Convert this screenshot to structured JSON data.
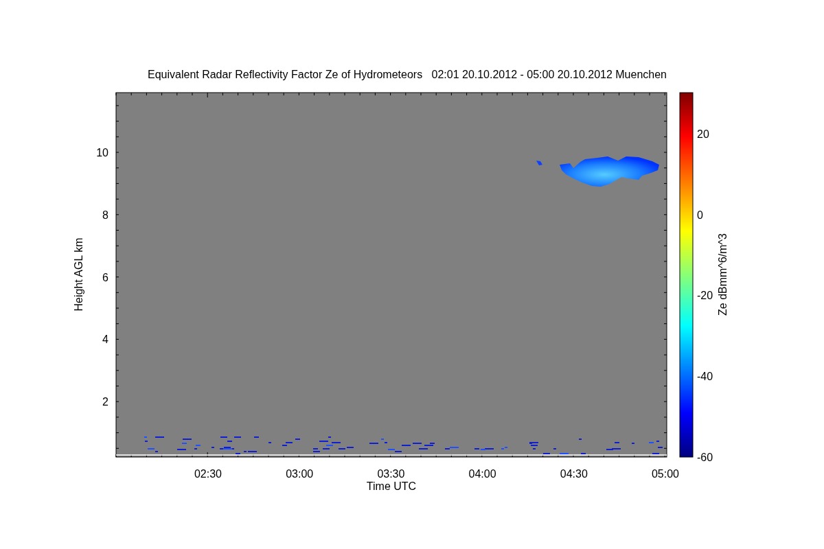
{
  "title": "Equivalent Radar Reflectivity Factor Ze of Hydrometeors   02:01 20.10.2012 - 05:00 20.10.2012 Muenchen",
  "y_axis": {
    "label": "Height AGL km",
    "ticks": [
      "10",
      "8",
      "6",
      "4",
      "2"
    ]
  },
  "x_axis": {
    "label": "Time UTC",
    "ticks": [
      "02:30",
      "03:00",
      "03:30",
      "04:00",
      "04:30",
      "05:00"
    ]
  },
  "colorbar": {
    "label": "Ze dBmm^6/m^3",
    "ticks": [
      "20",
      "0",
      "-20",
      "-40",
      "-60"
    ]
  }
}
